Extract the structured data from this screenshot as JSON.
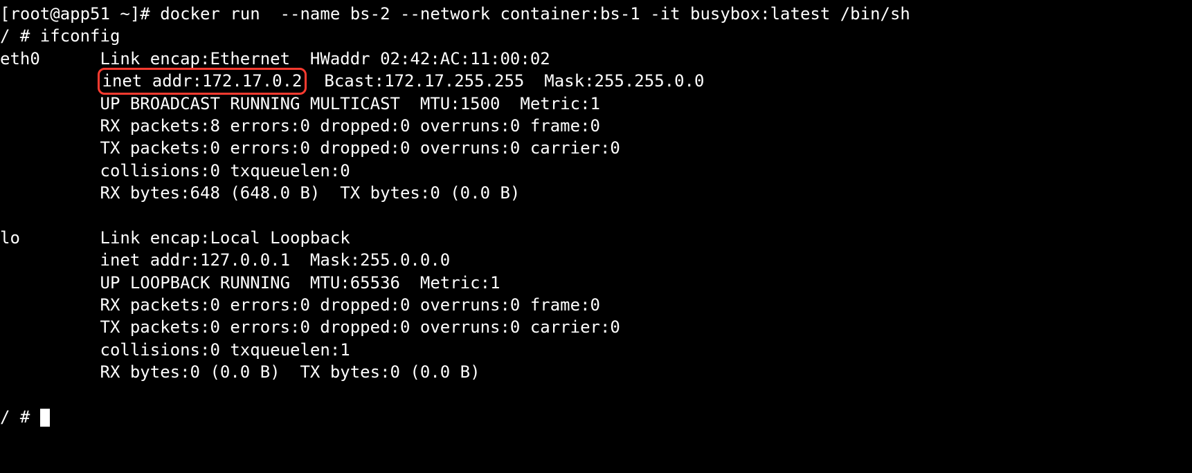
{
  "prompt1": "[root@app51 ~]# ",
  "cmd1": "docker run  --name bs-2 --network container:bs-1 -it busybox:latest /bin/sh",
  "prompt2": "/ # ",
  "cmd2": "ifconfig",
  "eth0": {
    "iface": "eth0",
    "indent": "          ",
    "l1": "Link encap:Ethernet  HWaddr 02:42:AC:11:00:02",
    "l2_highlight": "inet addr:172.17.0.2",
    "l2_rest": "  Bcast:172.17.255.255  Mask:255.255.0.0",
    "l3": "UP BROADCAST RUNNING MULTICAST  MTU:1500  Metric:1",
    "l4": "RX packets:8 errors:0 dropped:0 overruns:0 frame:0",
    "l5": "TX packets:0 errors:0 dropped:0 overruns:0 carrier:0",
    "l6": "collisions:0 txqueuelen:0",
    "l7": "RX bytes:648 (648.0 B)  TX bytes:0 (0.0 B)"
  },
  "lo": {
    "iface": "lo",
    "indent": "          ",
    "l1": "Link encap:Local Loopback",
    "l2": "inet addr:127.0.0.1  Mask:255.0.0.0",
    "l3": "UP LOOPBACK RUNNING  MTU:65536  Metric:1",
    "l4": "RX packets:0 errors:0 dropped:0 overruns:0 frame:0",
    "l5": "TX packets:0 errors:0 dropped:0 overruns:0 carrier:0",
    "l6": "collisions:0 txqueuelen:1",
    "l7": "RX bytes:0 (0.0 B)  TX bytes:0 (0.0 B)"
  },
  "prompt3": "/ # "
}
